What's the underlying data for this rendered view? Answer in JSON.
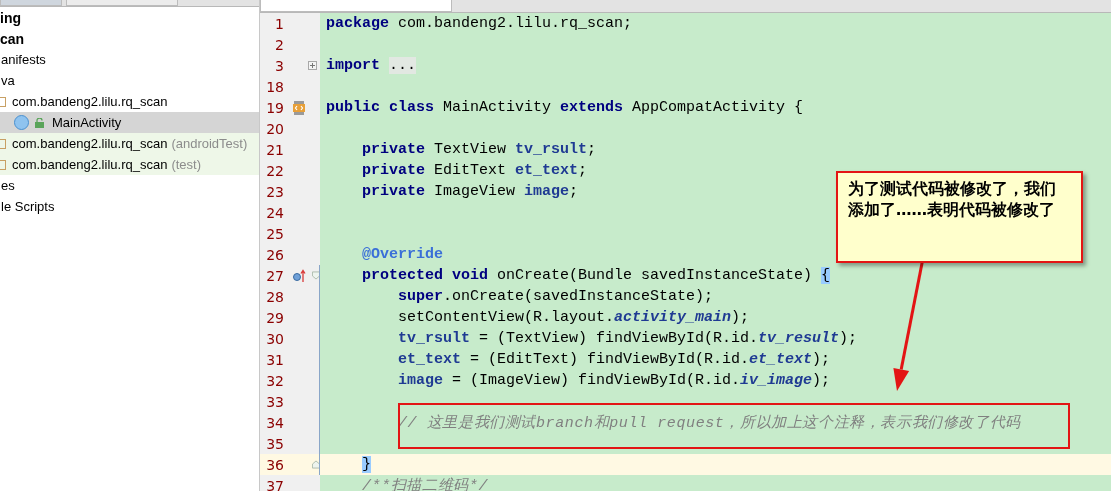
{
  "project_tree": [
    {
      "label": "ing",
      "kind": "module",
      "selected": false,
      "children": [
        {
          "label": "can",
          "kind": "module",
          "selected": false,
          "children": [
            {
              "label": "anifests",
              "kind": "folder",
              "selected": false
            },
            {
              "label": "va",
              "kind": "folder",
              "selected": false,
              "children": [
                {
                  "label": "com.bandeng2.lilu.rq_scan",
                  "kind": "package",
                  "selected": false,
                  "children": [
                    {
                      "label": "MainActivity",
                      "kind": "class",
                      "selected": true
                    }
                  ]
                },
                {
                  "label": "com.bandeng2.lilu.rq_scan",
                  "suffix": "(androidTest)",
                  "kind": "test-package",
                  "selected": false
                },
                {
                  "label": "com.bandeng2.lilu.rq_scan",
                  "suffix": "(test)",
                  "kind": "test-package",
                  "selected": false
                }
              ]
            },
            {
              "label": "es",
              "kind": "folder",
              "selected": false
            },
            {
              "label": "le Scripts",
              "kind": "folder",
              "selected": false
            }
          ]
        }
      ]
    }
  ],
  "editor": {
    "lines": [
      {
        "number": "1",
        "selected": false,
        "kind": "top",
        "segments": [
          {
            "kind": "keyword",
            "text": "package"
          },
          {
            "kind": "plain",
            "text": " com.bandeng2.lilu.rq_scan;"
          }
        ]
      },
      {
        "number": "2",
        "selected": false
      },
      {
        "number": "3",
        "selected": false,
        "kind": "top",
        "collapsed": true,
        "segments": [
          {
            "kind": "keyword",
            "text": "import "
          },
          {
            "kind": "folded",
            "text": "..."
          }
        ]
      },
      {
        "number": "18",
        "selected": false
      },
      {
        "number": "19",
        "selected": false,
        "kind": "top",
        "implements": true,
        "segments": [
          {
            "kind": "keyword",
            "text": "public "
          },
          {
            "kind": "keyword",
            "text": "class"
          },
          {
            "kind": "plain",
            "text": " MainActivity "
          },
          {
            "kind": "keyword",
            "text": "extends"
          },
          {
            "kind": "plain",
            "text": " AppCompatActivity {"
          }
        ]
      },
      {
        "number": "20",
        "selected": false
      },
      {
        "number": "21",
        "selected": false,
        "kind": "member",
        "segments": [
          {
            "kind": "keyword",
            "text": "private"
          },
          {
            "kind": "plain",
            "text": " TextView "
          },
          {
            "kind": "field",
            "text": "tv_rsult"
          },
          {
            "kind": "plain",
            "text": ";"
          }
        ]
      },
      {
        "number": "22",
        "selected": false,
        "kind": "member",
        "segments": [
          {
            "kind": "keyword",
            "text": "private"
          },
          {
            "kind": "plain",
            "text": " EditText "
          },
          {
            "kind": "field",
            "text": "et_text"
          },
          {
            "kind": "plain",
            "text": ";"
          }
        ]
      },
      {
        "number": "23",
        "selected": false,
        "kind": "member",
        "segments": [
          {
            "kind": "keyword",
            "text": "private"
          },
          {
            "kind": "plain",
            "text": " ImageView "
          },
          {
            "kind": "field",
            "text": "image"
          },
          {
            "kind": "plain",
            "text": ";"
          }
        ]
      },
      {
        "number": "24",
        "selected": false
      },
      {
        "number": "25",
        "selected": false
      },
      {
        "number": "26",
        "selected": false,
        "kind": "member",
        "segments": [
          {
            "kind": "annotation",
            "text": "@Override"
          }
        ]
      },
      {
        "number": "27",
        "selected": false,
        "kind": "member",
        "overrides": true,
        "fold_start": true,
        "segments": [
          {
            "kind": "keyword",
            "text": "protected "
          },
          {
            "kind": "keyword",
            "text": "void"
          },
          {
            "kind": "plain",
            "text": " onCreate(Bundle savedInstanceState) "
          },
          {
            "kind": "brace",
            "text": "{"
          }
        ]
      },
      {
        "number": "28",
        "selected": false,
        "kind": "body",
        "segments": [
          {
            "kind": "keyword",
            "text": "super"
          },
          {
            "kind": "plain",
            "text": ".onCreate(savedInstanceState);"
          }
        ]
      },
      {
        "number": "29",
        "selected": false,
        "kind": "body",
        "segments": [
          {
            "kind": "plain",
            "text": "setContentView(R.layout."
          },
          {
            "kind": "static",
            "text": "activity_main"
          },
          {
            "kind": "plain",
            "text": ");"
          }
        ]
      },
      {
        "number": "30",
        "selected": false,
        "kind": "body",
        "segments": [
          {
            "kind": "field",
            "text": "tv_rsult"
          },
          {
            "kind": "plain",
            "text": " = (TextView) findViewById(R.id."
          },
          {
            "kind": "static",
            "text": "tv_result"
          },
          {
            "kind": "plain",
            "text": ");"
          }
        ]
      },
      {
        "number": "31",
        "selected": false,
        "kind": "body",
        "segments": [
          {
            "kind": "field",
            "text": "et_text"
          },
          {
            "kind": "plain",
            "text": " = (EditText) findViewById(R.id."
          },
          {
            "kind": "static",
            "text": "et_text"
          },
          {
            "kind": "plain",
            "text": ");"
          }
        ]
      },
      {
        "number": "32",
        "selected": false,
        "kind": "body",
        "segments": [
          {
            "kind": "field",
            "text": "image"
          },
          {
            "kind": "plain",
            "text": " = (ImageView) findViewById(R.id."
          },
          {
            "kind": "static",
            "text": "iv_image"
          },
          {
            "kind": "plain",
            "text": ");"
          }
        ]
      },
      {
        "number": "33",
        "selected": false
      },
      {
        "number": "34",
        "selected": false,
        "kind": "body",
        "segments": [
          {
            "kind": "comment",
            "text": "// 这里是我们测试branch和pull request，所以加上这个注释，表示我们修改了代码"
          }
        ]
      },
      {
        "number": "35",
        "selected": false
      },
      {
        "number": "36",
        "selected": true,
        "kind": "member",
        "fold_end": true,
        "segments": [
          {
            "kind": "brace",
            "text": "}"
          }
        ]
      },
      {
        "number": "37",
        "selected": false,
        "kind": "member",
        "segments": [
          {
            "kind": "comment",
            "text": "/**扫描二维码*/"
          }
        ]
      }
    ]
  },
  "callout": {
    "text": "为了测试代码被修改了，我们添加了……表明代码被修改了"
  }
}
